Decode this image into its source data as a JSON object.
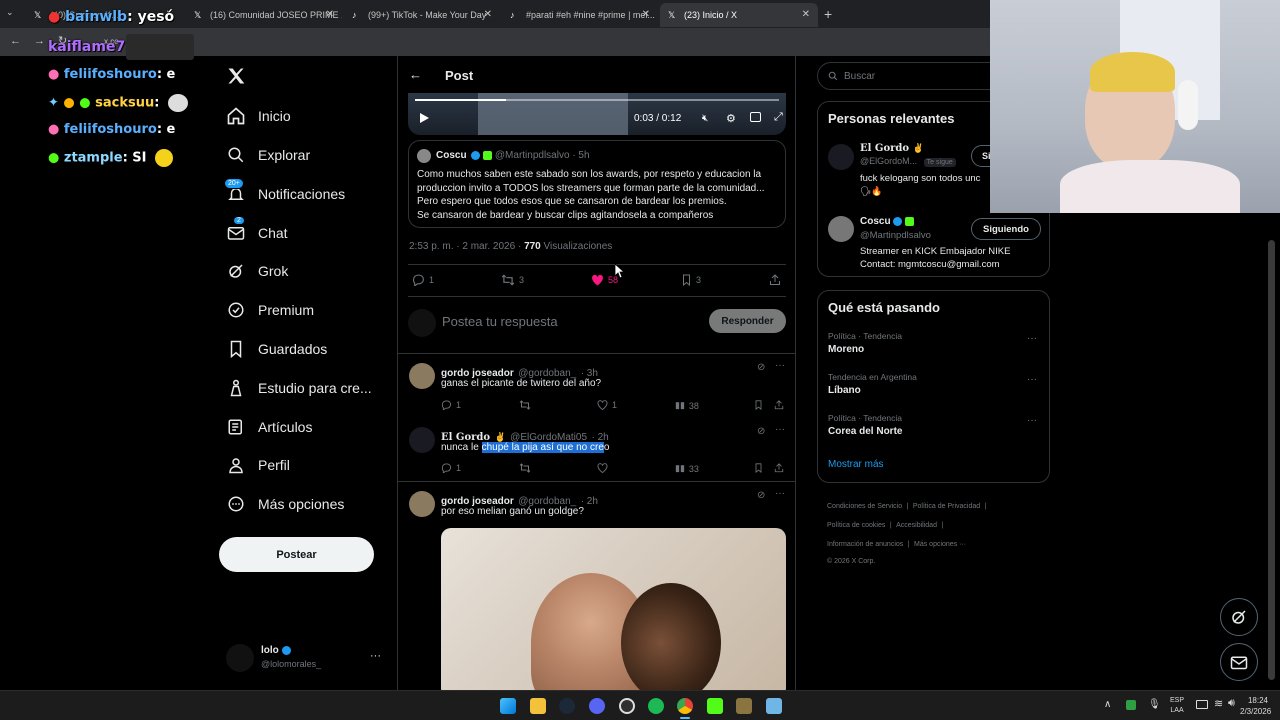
{
  "browser": {
    "tabs": [
      {
        "label": "(40) Guzu en K...",
        "active": false
      },
      {
        "label": "(16) Comunidad JOSEO PRIME ...",
        "active": false
      },
      {
        "label": "(99+) TikTok - Make Your Day",
        "active": false
      },
      {
        "label": "#parati #eh #nine #prime | mel...",
        "active": false
      },
      {
        "label": "(23) Inicio / X",
        "active": true
      }
    ],
    "new_tab": "+",
    "url_fragment": "x.co"
  },
  "chat": {
    "messages": [
      {
        "user": "bainwlb",
        "text": ": yesó",
        "color": "#5ab0ff"
      },
      {
        "user": "kaiflame7",
        "text": ":",
        "color": "#b06cff"
      },
      {
        "user": "feliifoshouro",
        "text": ": e",
        "color": "#5ab0ff"
      },
      {
        "user": "sacksuu",
        "text": ":",
        "color": "#ffd23f"
      },
      {
        "user": "feliifoshouro",
        "text": ": e",
        "color": "#5ab0ff"
      },
      {
        "user": "ztample",
        "text": ": SI",
        "color": "#8ed8ff"
      }
    ]
  },
  "nav": {
    "logo": "X",
    "items": [
      {
        "label": "Inicio",
        "icon": "home-icon"
      },
      {
        "label": "Explorar",
        "icon": "search-icon"
      },
      {
        "label": "Notificaciones",
        "icon": "bell-icon",
        "badge": "20+"
      },
      {
        "label": "Chat",
        "icon": "mail-icon",
        "badge": "2"
      },
      {
        "label": "Grok",
        "icon": "grok-icon"
      },
      {
        "label": "Premium",
        "icon": "premium-icon"
      },
      {
        "label": "Guardados",
        "icon": "bookmark-icon"
      },
      {
        "label": "Estudio para cre...",
        "icon": "studio-icon"
      },
      {
        "label": "Artículos",
        "icon": "articles-icon"
      },
      {
        "label": "Perfil",
        "icon": "profile-icon"
      },
      {
        "label": "Más opciones",
        "icon": "more-icon"
      }
    ],
    "post_button": "Postear",
    "account": {
      "name": "lolo",
      "handle": "@lolomorales_",
      "more": "···"
    }
  },
  "post": {
    "header": "Post",
    "video": {
      "time": "0:03 / 0:12",
      "progress": 0.25
    },
    "quoted": {
      "name": "Coscu",
      "handle": "@Martinpdlsalvo",
      "age": "· 5h",
      "lines": [
        "Como muchos saben este sabado son los awards, por respeto y educacion la",
        "produccion invito a TODOS los streamers que forman parte de la comunidad...",
        "Pero espero que todos esos que se cansaron de bardear los premios.",
        "Se cansaron de bardear y buscar clips agitandosela a compañeros"
      ]
    },
    "meta": {
      "time": "2:53 p. m. · 2 mar. 2026 ·",
      "views": "770",
      "views_label": "Visualizaciones"
    },
    "stats": {
      "replies": "1",
      "reposts": "3",
      "likes": "58",
      "bookmarks": "3"
    },
    "compose": {
      "placeholder": "Postea tu respuesta",
      "button": "Responder"
    }
  },
  "replies": [
    {
      "name": "gordo joseador",
      "handle": "@gordoban_",
      "age": "· 3h",
      "text": "ganas el picante de twitero del año?",
      "replies": "1",
      "likes": "1",
      "views": "38"
    },
    {
      "name": "El Gordo",
      "handle": "@ElGordoMati05",
      "age": "· 2h",
      "text_before": "nunca le ",
      "text_selected": "chupé la pija así que no cre",
      "text_after": "o",
      "replies": "1",
      "likes": "",
      "views": "33"
    },
    {
      "name": "gordo joseador",
      "handle": "@gordoban_",
      "age": "· 2h",
      "text": "por eso melian ganó un goldge?"
    }
  ],
  "right": {
    "search_placeholder": "Buscar",
    "relevant": {
      "title": "Personas relevantes",
      "people": [
        {
          "name": "El Gordo",
          "handle": "@ElGordoM...",
          "follows_you": "Te sigue",
          "button": "Si",
          "bio": "fuck kelogang son todos unc"
        },
        {
          "name": "Coscu",
          "handle": "@Martinpdlsalvo",
          "button": "Siguiendo",
          "bio_lines": [
            "Streamer en KICK Embajador NIKE",
            "Contact: mgmtcoscu@gmail.com"
          ]
        }
      ]
    },
    "trending": {
      "title": "Qué está pasando",
      "items": [
        {
          "context": "Política · Tendencia",
          "topic": "Moreno"
        },
        {
          "context": "Tendencia en Argentina",
          "topic": "Líbano"
        },
        {
          "context": "Política · Tendencia",
          "topic": "Corea del Norte"
        }
      ],
      "show_more": "Mostrar más"
    },
    "footer": [
      "Condiciones de Servicio",
      "Política de Privacidad",
      "Política de cookies",
      "Accesibilidad",
      "Información de anuncios",
      "Más opciones ···",
      "© 2026 X Corp."
    ]
  },
  "taskbar": {
    "lang": "ESP",
    "lang2": "LAA",
    "time": "18:24",
    "date": "2/3/2026"
  },
  "colors": {
    "accent": "#1d9bf0",
    "like": "#f91880",
    "background": "#000000",
    "border": "#2f3336"
  }
}
